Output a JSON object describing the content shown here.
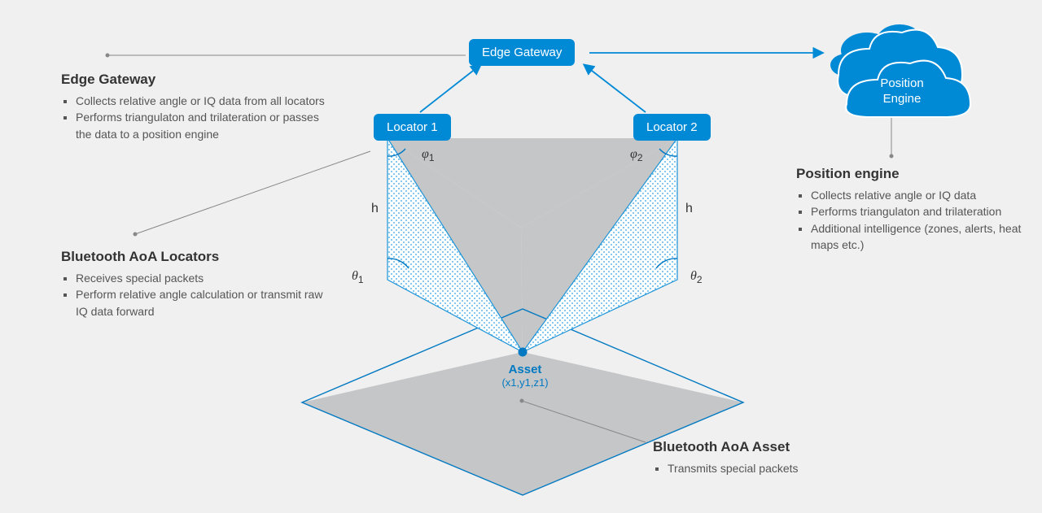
{
  "nodes": {
    "edge_gateway": "Edge Gateway",
    "locator1": "Locator 1",
    "locator2": "Locator 2"
  },
  "labels": {
    "phi1": "φ",
    "phi2": "φ",
    "theta1": "θ",
    "theta2": "θ",
    "h_left": "h",
    "h_right": "h",
    "asset_title": "Asset",
    "asset_coord": "(x1,y1,z1)"
  },
  "cloud": {
    "line1": "Position",
    "line2": "Engine"
  },
  "edge_gateway_block": {
    "title": "Edge Gateway",
    "b1": "Collects relative angle or IQ data from all locators",
    "b2": "Performs triangulaton and trilateration or passes the data to a position engine"
  },
  "locators_block": {
    "title": "Bluetooth AoA Locators",
    "b1": "Receives special packets",
    "b2": "Perform relative angle calculation or transmit raw IQ data forward"
  },
  "asset_block": {
    "title": "Bluetooth AoA Asset",
    "b1": "Transmits special packets"
  },
  "position_block": {
    "title": "Position engine",
    "b1": "Collects relative angle or IQ data",
    "b2": "Performs triangulaton and trilateration",
    "b3": "Additional intelligence (zones, alerts, heat maps etc.)"
  }
}
